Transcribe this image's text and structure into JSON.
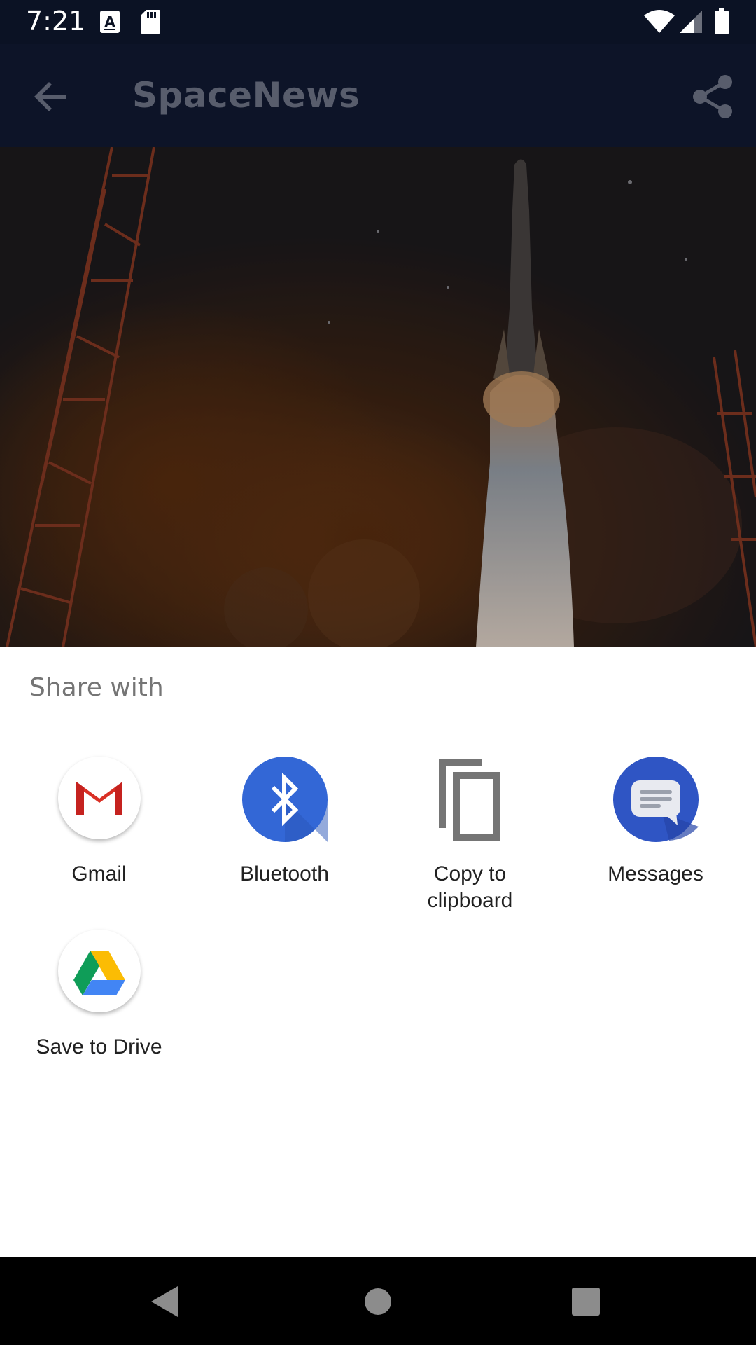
{
  "status_bar": {
    "time": "7:21",
    "icons": [
      "a-notification-icon",
      "sd-card-icon",
      "wifi-icon",
      "signal-icon",
      "battery-icon"
    ]
  },
  "app_bar": {
    "title": "SpaceNews",
    "icons": [
      "back-arrow-icon",
      "share-icon"
    ]
  },
  "hero": {
    "description_icon": "rocket-launch-image"
  },
  "share_sheet": {
    "title": "Share with",
    "targets": [
      {
        "label": "Gmail",
        "icon": "gmail-icon"
      },
      {
        "label": "Bluetooth",
        "icon": "bluetooth-icon",
        "color": "#3367d6"
      },
      {
        "label": "Copy to\nclipboard",
        "icon": "copy-icon"
      },
      {
        "label": "Messages",
        "icon": "messages-icon",
        "color": "#2f55c4"
      },
      {
        "label": "Save to Drive",
        "icon": "google-drive-icon"
      }
    ]
  },
  "nav_bar": {
    "icons": [
      "nav-back-icon",
      "nav-home-icon",
      "nav-recents-icon"
    ]
  },
  "colors": {
    "app_bar_bg": "#0d1428",
    "sheet_bg": "#ffffff",
    "title_text": "#757575"
  }
}
